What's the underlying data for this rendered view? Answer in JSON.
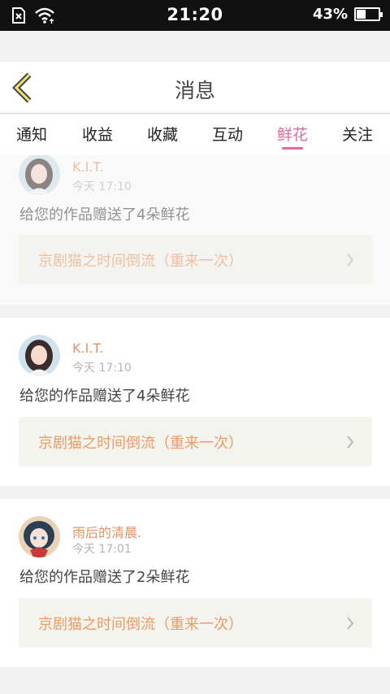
{
  "status_bar": {
    "time": "21:20",
    "battery": "43%",
    "battery_level": 0.43,
    "icons": [
      "no-sim-icon",
      "wifi-icon",
      "battery-icon"
    ]
  },
  "header": {
    "title": "消息",
    "back_icon": "chevron-left-icon"
  },
  "tabs": [
    {
      "label": "通知"
    },
    {
      "label": "收益"
    },
    {
      "label": "收藏"
    },
    {
      "label": "互动"
    },
    {
      "label": "鲜花",
      "active": true
    },
    {
      "label": "关注"
    }
  ],
  "colors": {
    "accent": "#e26a9d",
    "sender": "#e8925f",
    "work_title": "#ee9a64",
    "work_bg": "#f4f4ef"
  },
  "messages": [
    {
      "sender": "K.I.T.",
      "time": "今天 17:10",
      "text": "给您的作品赠送了4朵鲜花",
      "work": "京剧猫之时间倒流（重来一次）"
    },
    {
      "sender": "K.I.T.",
      "time": "今天 17:10",
      "text": "给您的作品赠送了4朵鲜花",
      "work": "京剧猫之时间倒流（重来一次）"
    },
    {
      "sender": "雨后的清晨.",
      "time": "今天 17:01",
      "text": "给您的作品赠送了2朵鲜花",
      "work": "京剧猫之时间倒流（重来一次）"
    }
  ]
}
